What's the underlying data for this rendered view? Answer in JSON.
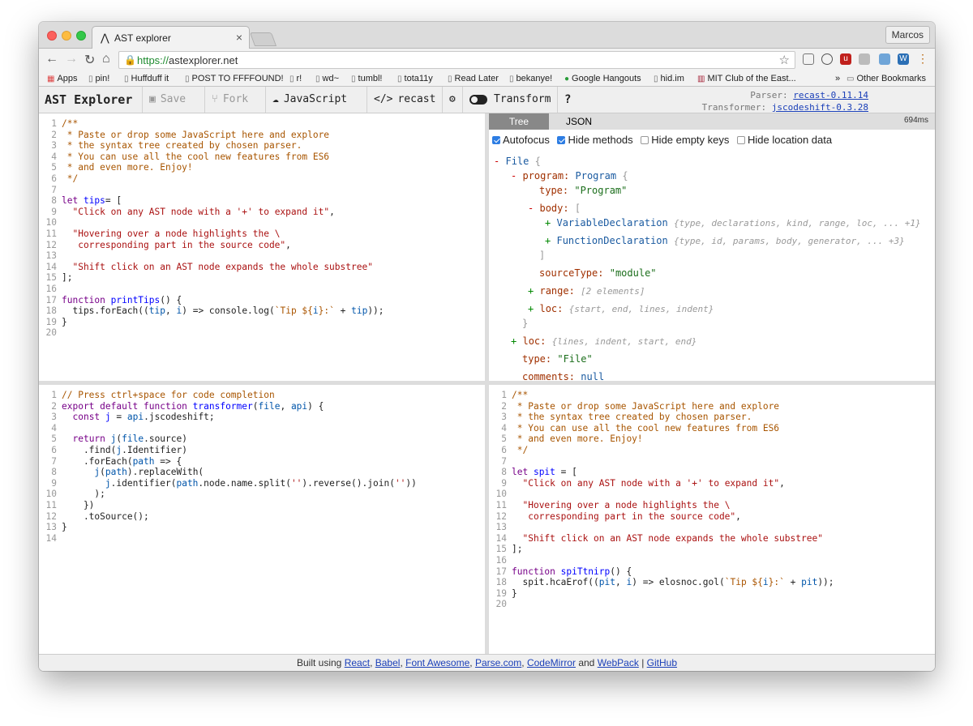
{
  "browser": {
    "tab_title": "AST explorer",
    "profile": "Marcos",
    "url_scheme": "https://",
    "url_host": "astexplorer.net"
  },
  "bookmarks": [
    "Apps",
    "pin!",
    "Huffduff it",
    "POST TO FFFFOUND!",
    "r!",
    "wd~",
    "tumbl!",
    "tota11y",
    "Read Later",
    "bekanye!",
    "Google Hangouts",
    "hid.im",
    "MIT Club of the East...",
    "Other Bookmarks"
  ],
  "toolbar": {
    "brand": "AST Explorer",
    "save": "Save",
    "fork": "Fork",
    "language": "JavaScript",
    "parser": "recast",
    "transform": "Transform",
    "help": "?",
    "parser_label": "Parser:",
    "parser_value": "recast-0.11.14",
    "transformer_label": "Transformer:",
    "transformer_value": "jscodeshift-0.3.28"
  },
  "ast": {
    "tab_tree": "Tree",
    "tab_json": "JSON",
    "time": "694ms",
    "opt_autofocus": "Autofocus",
    "opt_hide_methods": "Hide methods",
    "opt_hide_empty": "Hide empty keys",
    "opt_hide_location": "Hide location data",
    "nodes": {
      "file": "File",
      "program_key": "program:",
      "program_type": "Program",
      "type_key": "type:",
      "program_str": "\"Program\"",
      "body_key": "body:",
      "var_decl": "VariableDeclaration",
      "var_summary": "{type, declarations, kind, range, loc, ... +1}",
      "func_decl": "FunctionDeclaration",
      "func_summary": "{type, id, params, body, generator, ... +3}",
      "source_type_key": "sourceType:",
      "source_type_val": "\"module\"",
      "range_key": "range:",
      "range_summary": "[2 elements]",
      "loc_key": "loc:",
      "loc_summary": "{start, end, lines, indent}",
      "loc2_summary": "{lines, indent, start, end}",
      "file_str": "\"File\"",
      "comments_key": "comments:",
      "comments_val": "null"
    }
  },
  "footer": {
    "prefix": "Built using",
    "links": [
      "React",
      "Babel",
      "Font Awesome",
      "Parse.com",
      "CodeMirror",
      "WebPack",
      "GitHub"
    ],
    "and": "and",
    "sep": "|"
  },
  "source_code": [
    [
      [
        "c-com",
        "/**"
      ]
    ],
    [
      [
        "c-com",
        " * Paste or drop some JavaScript here and explore"
      ]
    ],
    [
      [
        "c-com",
        " * the syntax tree created by chosen parser."
      ]
    ],
    [
      [
        "c-com",
        " * You can use all the cool new features from ES6"
      ]
    ],
    [
      [
        "c-com",
        " * and even more. Enjoy!"
      ]
    ],
    [
      [
        "c-com",
        " */"
      ]
    ],
    [],
    [
      [
        "c-kw",
        "let "
      ],
      [
        "c-def",
        "tips"
      ],
      [
        "",
        "= ["
      ]
    ],
    [
      [
        "",
        "  "
      ],
      [
        "c-str",
        "\"Click on any AST node with a '+' to expand it\""
      ],
      [
        "",
        ","
      ]
    ],
    [],
    [
      [
        "",
        "  "
      ],
      [
        "c-str",
        "\"Hovering over a node highlights the \\"
      ]
    ],
    [
      [
        "c-str",
        "   corresponding part in the source code\""
      ],
      [
        "",
        ","
      ]
    ],
    [],
    [
      [
        "",
        "  "
      ],
      [
        "c-str",
        "\"Shift click on an AST node expands the whole substree\""
      ]
    ],
    [
      [
        "",
        "];"
      ]
    ],
    [],
    [
      [
        "c-kw",
        "function "
      ],
      [
        "c-def",
        "printTips"
      ],
      [
        "",
        "() {"
      ]
    ],
    [
      [
        "",
        "  tips.forEach(("
      ],
      [
        "c-var",
        "tip"
      ],
      [
        "",
        ", "
      ],
      [
        "c-var",
        "i"
      ],
      [
        "",
        ") => console.log("
      ],
      [
        "c-tmpl",
        "`Tip ${"
      ],
      [
        "c-var",
        "i"
      ],
      [
        "c-tmpl",
        "}:`"
      ],
      [
        "",
        " + "
      ],
      [
        "c-var",
        "tip"
      ],
      [
        "",
        "));"
      ]
    ],
    [
      [
        "",
        "}"
      ]
    ],
    []
  ],
  "transform_code": [
    [
      [
        "c-com",
        "// Press ctrl+space for code completion"
      ]
    ],
    [
      [
        "c-kw",
        "export default function "
      ],
      [
        "c-def",
        "transformer"
      ],
      [
        "",
        "("
      ],
      [
        "c-var",
        "file"
      ],
      [
        "",
        ", "
      ],
      [
        "c-var",
        "api"
      ],
      [
        "",
        ") {"
      ]
    ],
    [
      [
        "",
        "  "
      ],
      [
        "c-kw",
        "const "
      ],
      [
        "c-def",
        "j"
      ],
      [
        "",
        " = "
      ],
      [
        "c-var",
        "api"
      ],
      [
        "",
        ".jscodeshift;"
      ]
    ],
    [],
    [
      [
        "",
        "  "
      ],
      [
        "c-kw",
        "return "
      ],
      [
        "c-var",
        "j"
      ],
      [
        "",
        "("
      ],
      [
        "c-var",
        "file"
      ],
      [
        "",
        ".source)"
      ]
    ],
    [
      [
        "",
        "    .find("
      ],
      [
        "c-var",
        "j"
      ],
      [
        "",
        ".Identifier)"
      ]
    ],
    [
      [
        "",
        "    .forEach("
      ],
      [
        "c-var",
        "path"
      ],
      [
        "",
        " => {"
      ]
    ],
    [
      [
        "",
        "      "
      ],
      [
        "c-var",
        "j"
      ],
      [
        "",
        "("
      ],
      [
        "c-var",
        "path"
      ],
      [
        "",
        ").replaceWith("
      ]
    ],
    [
      [
        "",
        "        "
      ],
      [
        "c-var",
        "j"
      ],
      [
        "",
        ".identifier("
      ],
      [
        "c-var",
        "path"
      ],
      [
        "",
        ".node.name.split("
      ],
      [
        "c-str",
        "''"
      ],
      [
        "",
        ").reverse().join("
      ],
      [
        "c-str",
        "''"
      ],
      [
        "",
        "))"
      ]
    ],
    [
      [
        "",
        "      );"
      ]
    ],
    [
      [
        "",
        "    })"
      ]
    ],
    [
      [
        "",
        "    .toSource();"
      ]
    ],
    [
      [
        "",
        "}"
      ]
    ],
    []
  ],
  "output_code": [
    [
      [
        "c-com",
        "/**"
      ]
    ],
    [
      [
        "c-com",
        " * Paste or drop some JavaScript here and explore"
      ]
    ],
    [
      [
        "c-com",
        " * the syntax tree created by chosen parser."
      ]
    ],
    [
      [
        "c-com",
        " * You can use all the cool new features from ES6"
      ]
    ],
    [
      [
        "c-com",
        " * and even more. Enjoy!"
      ]
    ],
    [
      [
        "c-com",
        " */"
      ]
    ],
    [],
    [
      [
        "c-kw",
        "let "
      ],
      [
        "c-def",
        "spit"
      ],
      [
        "",
        " = ["
      ]
    ],
    [
      [
        "",
        "  "
      ],
      [
        "c-str",
        "\"Click on any AST node with a '+' to expand it\""
      ],
      [
        "",
        ","
      ]
    ],
    [],
    [
      [
        "",
        "  "
      ],
      [
        "c-str",
        "\"Hovering over a node highlights the \\"
      ]
    ],
    [
      [
        "c-str",
        "   corresponding part in the source code\""
      ],
      [
        "",
        ","
      ]
    ],
    [],
    [
      [
        "",
        "  "
      ],
      [
        "c-str",
        "\"Shift click on an AST node expands the whole substree\""
      ]
    ],
    [
      [
        "",
        "];"
      ]
    ],
    [],
    [
      [
        "c-kw",
        "function "
      ],
      [
        "c-def",
        "spiTtnirp"
      ],
      [
        "",
        "() {"
      ]
    ],
    [
      [
        "",
        "  spit.hcaErof(("
      ],
      [
        "c-var",
        "pit"
      ],
      [
        "",
        ", "
      ],
      [
        "c-var",
        "i"
      ],
      [
        "",
        ") => elosnoc.gol("
      ],
      [
        "c-tmpl",
        "`Tip ${"
      ],
      [
        "c-var",
        "i"
      ],
      [
        "c-tmpl",
        "}:`"
      ],
      [
        "",
        " + "
      ],
      [
        "c-var",
        "pit"
      ],
      [
        "",
        "));"
      ]
    ],
    [
      [
        "",
        "}"
      ]
    ],
    []
  ]
}
